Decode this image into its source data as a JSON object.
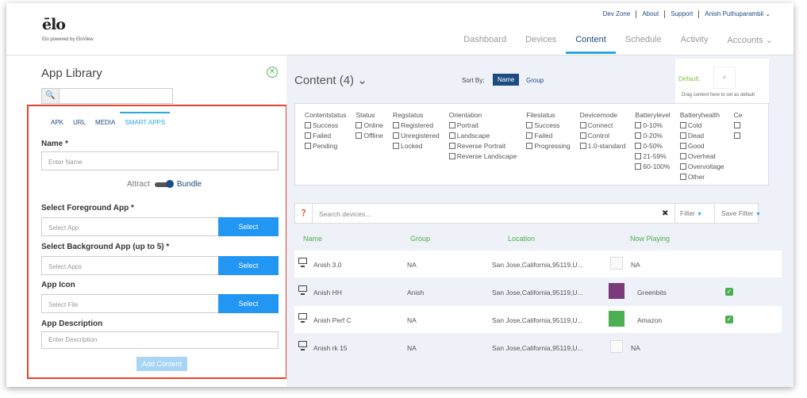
{
  "header": {
    "logo": "ēlo",
    "powered_by": "Elo powered by EloView",
    "top_links": [
      "Dev Zone",
      "About",
      "Support",
      "Anish Puthuparambil ⌄"
    ],
    "nav": [
      "Dashboard",
      "Devices",
      "Content",
      "Schedule",
      "Activity",
      "Accounts ⌄"
    ],
    "active_nav": "Content"
  },
  "library": {
    "title": "App Library",
    "tabs": [
      "APK",
      "URL",
      "MEDIA",
      "SMART APPS"
    ],
    "active_tab": "SMART APPS",
    "name_label": "Name *",
    "name_placeholder": "Enter Name",
    "attract_label": "Attract",
    "bundle_label": "Bundle",
    "fg_label": "Select Foreground App *",
    "fg_placeholder": "Select App",
    "bg_label": "Select Background App (up to 5) *",
    "bg_placeholder": "Select Apps",
    "icon_label": "App Icon",
    "icon_placeholder": "Select File",
    "select_label": "Select",
    "desc_label": "App Description",
    "desc_placeholder": "Enter Description",
    "add_button": "Add Content"
  },
  "content": {
    "title": "Content (4) ⌄",
    "sort_by_label": "Sort By:",
    "sort_name": "Name",
    "sort_group": "Group",
    "default_label": "Default:",
    "default_plus": "+",
    "default_hint": "Drag content here to set as default"
  },
  "filters": [
    {
      "title": "Contentstatus",
      "options": [
        "Success",
        "Failed",
        "Pending"
      ]
    },
    {
      "title": "Status",
      "options": [
        "Online",
        "Offline"
      ]
    },
    {
      "title": "Regstatus",
      "options": [
        "Registered",
        "Unregistered",
        "Locked"
      ]
    },
    {
      "title": "Orientation",
      "options": [
        "Portrait",
        "Landscape",
        "Reverse Portrait",
        "Reverse Landscape"
      ]
    },
    {
      "title": "Filestatus",
      "options": [
        "Success",
        "Failed",
        "Progressing"
      ]
    },
    {
      "title": "Devicemode",
      "options": [
        "Connect",
        "Control",
        "1.0-standard"
      ]
    },
    {
      "title": "Batterylevel",
      "options": [
        "0-10%",
        "0-20%",
        "0-50%",
        "21-59%",
        "60-100%"
      ]
    },
    {
      "title": "Batteryhealth",
      "options": [
        "Cold",
        "Dead",
        "Good",
        "Overheat",
        "Overvoltage",
        "Other"
      ]
    },
    {
      "title": "Ce",
      "options": [
        "",
        ""
      ]
    }
  ],
  "search": {
    "placeholder": "Search devices...",
    "clear": "✖",
    "filter_label": "Filter",
    "save_filter_label": "Save Filter"
  },
  "table": {
    "headers": [
      "Name",
      "Group",
      "Location",
      "Now Playing"
    ],
    "rows": [
      {
        "name": "Anish 3.0",
        "group": "NA",
        "location": "San Jose,California,95119,U...",
        "playing": "NA",
        "thumb": "empty",
        "check": false
      },
      {
        "name": "Anish HH",
        "group": "Anish",
        "location": "San Jose,California,95119,U...",
        "playing": "Greenbits",
        "thumb": "#7a3b7a",
        "check": true
      },
      {
        "name": "Anish Perf C",
        "group": "NA",
        "location": "San Jose,California,95119,U...",
        "playing": "Amazon",
        "thumb": "#4caf50",
        "check": true
      },
      {
        "name": "Anish rk 15",
        "group": "NA",
        "location": "San Jose,California,95119,U...",
        "playing": "NA",
        "thumb": "empty",
        "check": false
      }
    ]
  },
  "colors": {
    "accent": "#29a7e1",
    "brand": "#1d4a80",
    "highlight": "#e8412c",
    "success": "#4caf50"
  }
}
